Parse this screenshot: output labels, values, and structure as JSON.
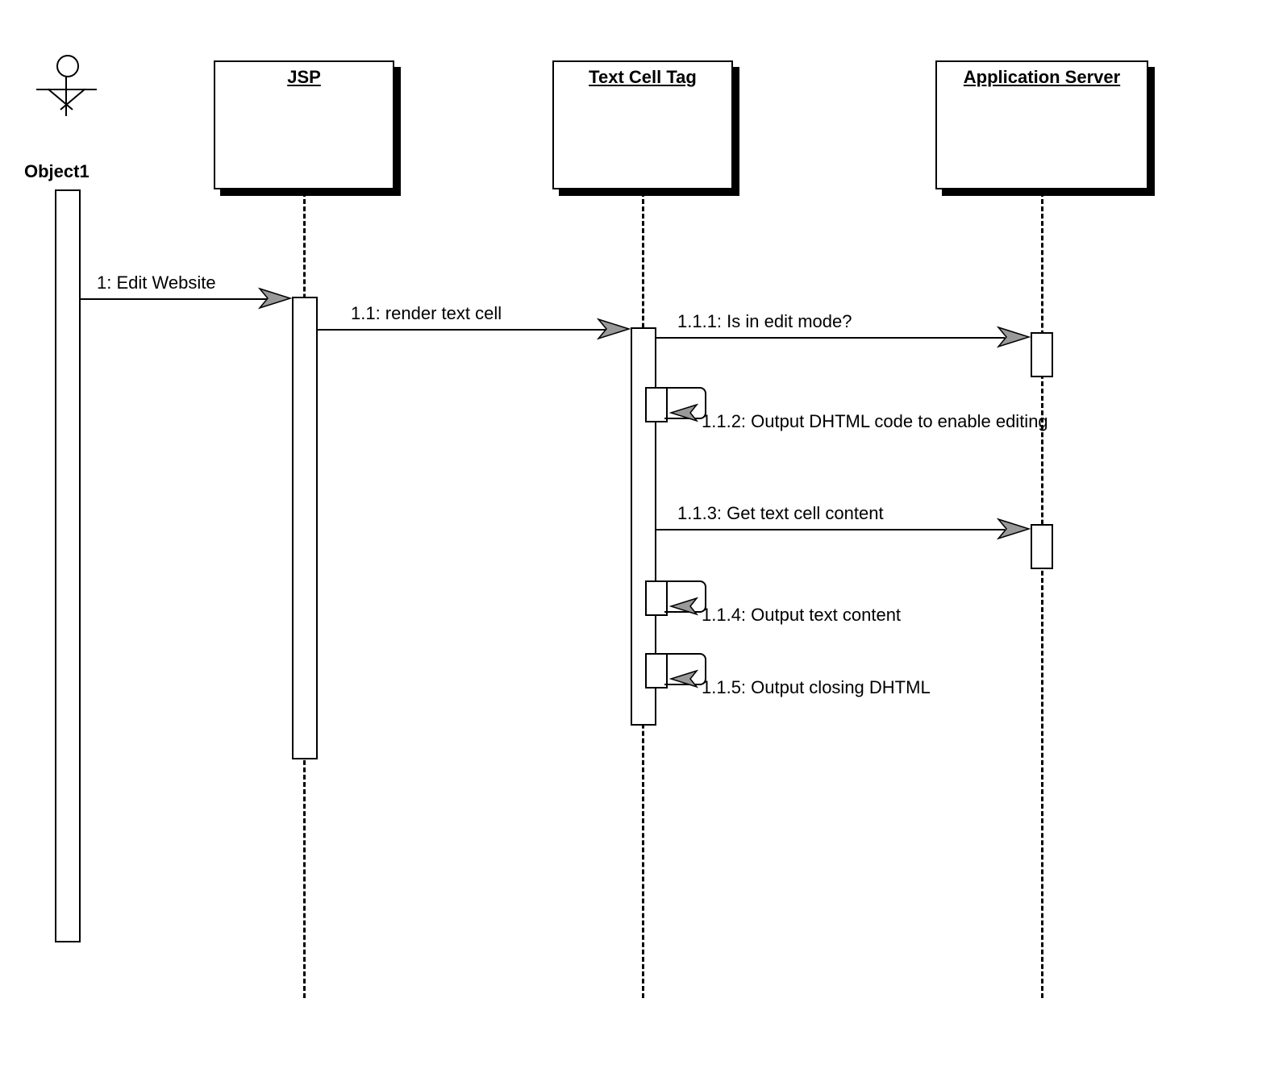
{
  "actor": {
    "label": "Object1"
  },
  "lifelines": {
    "jsp": "JSP",
    "textCellTag": "Text Cell Tag",
    "appServer": "Application Server"
  },
  "messages": {
    "m1": "1: Edit Website",
    "m11": "1.1: render text cell",
    "m111": "1.1.1: Is in edit mode?",
    "m112": "1.1.2: Output DHTML code to enable editing",
    "m113": "1.1.3: Get text cell content",
    "m114": "1.1.4: Output text content",
    "m115": "1.1.5: Output closing DHTML"
  }
}
